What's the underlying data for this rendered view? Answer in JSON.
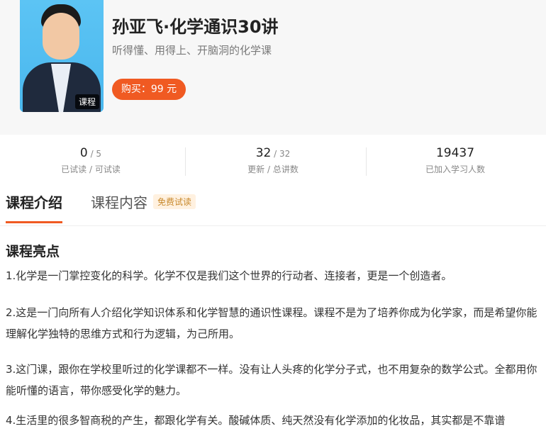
{
  "course": {
    "title": "孙亚飞·化学通识30讲",
    "subtitle": "听得懂、用得上、开脑洞的化学课",
    "buy_label": "购买：99 元",
    "cover_badge": "课程"
  },
  "stats": [
    {
      "value": "0",
      "total": " / 5",
      "label": "已试读 / 可试读"
    },
    {
      "value": "32",
      "total": " / 32",
      "label": "更新 / 总讲数"
    },
    {
      "value": "19437",
      "total": "",
      "label": "已加入学习人数"
    }
  ],
  "tabs": [
    {
      "label": "课程介绍",
      "active": true
    },
    {
      "label": "课程内容",
      "active": false
    }
  ],
  "free_badge": "免费试读",
  "section_title": "课程亮点",
  "paragraphs": [
    "1.化学是一门掌控变化的科学。化学不仅是我们这个世界的行动者、连接者，更是一个创造者。",
    "2.这是一门向所有人介绍化学知识体系和化学智慧的通识性课程。课程不是为了培养你成为化学家，而是希望你能理解化学独特的思维方式和行为逻辑，为己所用。",
    "3.这门课，跟你在学校里听过的化学课都不一样。没有让人头疼的化学分子式，也不用复杂的数学公式。全都用你能听懂的语言，带你感受化学的魅力。",
    "4.生活里的很多智商税的产生，都跟化学有关。酸碱体质、纯天然没有化学添加的化妆品，其实都是不靠谱"
  ],
  "colors": {
    "accent": "#f05a22",
    "badge_bg": "#fff1e0",
    "badge_text": "#c8892c"
  }
}
